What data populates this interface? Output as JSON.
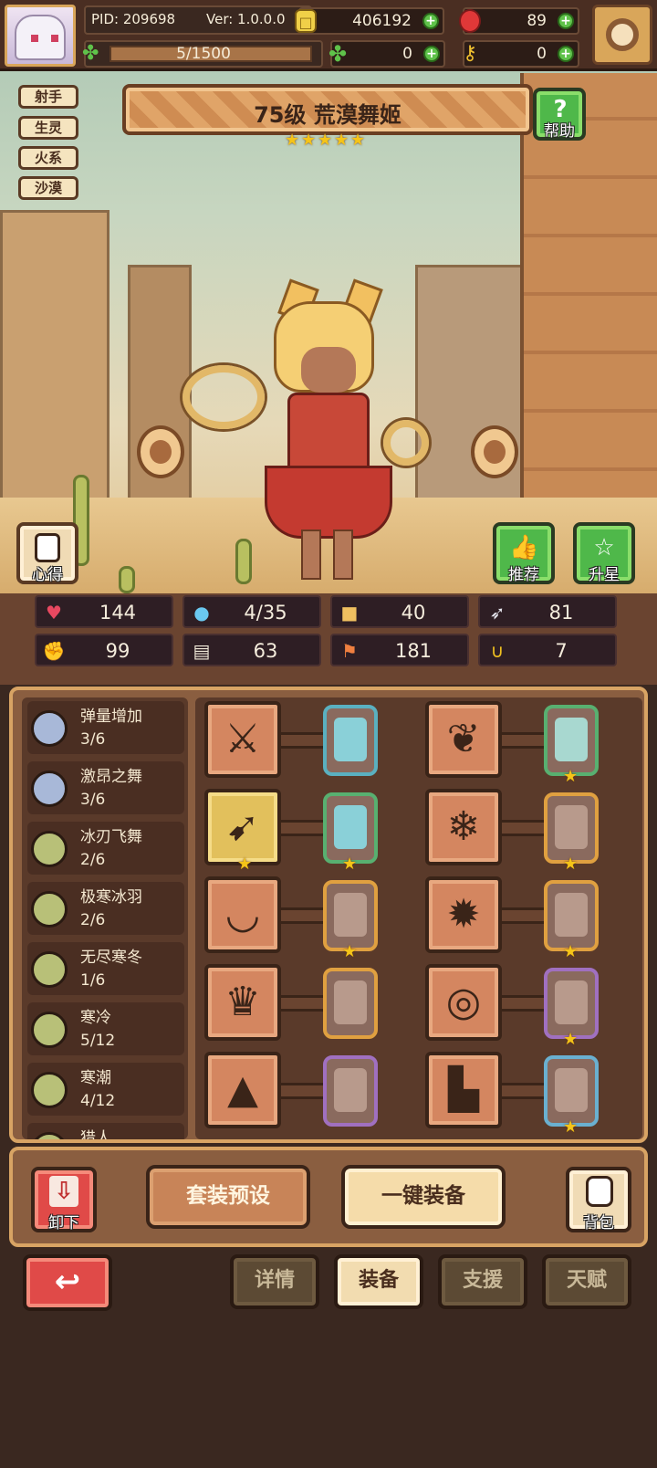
{
  "player": {
    "pid": "PID: 209698",
    "version": "Ver: 1.0.0.0",
    "energy": "5/1500"
  },
  "currency": {
    "gold": "406192",
    "ruby": "89",
    "clover": "0",
    "key": "0"
  },
  "tags": [
    "射手",
    "生灵",
    "火系",
    "沙漠"
  ],
  "hero": {
    "title": "75级  荒漠舞姬",
    "stars": 5
  },
  "buttons": {
    "help": "帮助",
    "insight": "心得",
    "recommend": "推荐",
    "star_up": "升星",
    "unload": "卸下",
    "set_preset": "套装预设",
    "one_click_equip": "一键装备",
    "backpack": "背包"
  },
  "icons": {
    "help": "?",
    "back": "↩"
  },
  "stats": [
    {
      "icon": "heart-icon",
      "glyph": "♥",
      "value": "144",
      "color": "#e84860"
    },
    {
      "icon": "water-drop-icon",
      "glyph": "●",
      "value": "4/35",
      "color": "#6ac8f0"
    },
    {
      "icon": "shield-icon",
      "glyph": "■",
      "value": "40",
      "color": "#f0c060"
    },
    {
      "icon": "wing-icon",
      "glyph": "➶",
      "value": "81",
      "color": "#e8e8f0"
    },
    {
      "icon": "fist-icon",
      "glyph": "✊",
      "value": "99",
      "color": "#9ad0f0"
    },
    {
      "icon": "book-icon",
      "glyph": "▤",
      "value": "63",
      "color": "#f0e8d8"
    },
    {
      "icon": "flag-icon",
      "glyph": "⚑",
      "value": "181",
      "color": "#f08040"
    },
    {
      "icon": "horseshoe-icon",
      "glyph": "∪",
      "value": "7",
      "color": "#f0c020"
    }
  ],
  "skills": [
    {
      "name": "弹量增加",
      "count": "3/6",
      "color": "#a8b8d8"
    },
    {
      "name": "激昂之舞",
      "count": "3/6",
      "color": "#a8b8d8"
    },
    {
      "name": "冰刃飞舞",
      "count": "2/6",
      "color": "#b8c078"
    },
    {
      "name": "极寒冰羽",
      "count": "2/6",
      "color": "#b8c078"
    },
    {
      "name": "无尽寒冬",
      "count": "1/6",
      "color": "#b8c078"
    },
    {
      "name": "寒冷",
      "count": "5/12",
      "color": "#b8c078"
    },
    {
      "name": "寒潮",
      "count": "4/12",
      "color": "#b8c078"
    },
    {
      "name": "猎人",
      "count": "",
      "color": "#b8c078"
    }
  ],
  "equipment": [
    {
      "slot": "crossbow",
      "glyph": "⚔",
      "gold": false,
      "gem_color": "#8ad0d8",
      "gem_border": "#5ab0c0",
      "gem_star": false
    },
    {
      "slot": "necklace-red",
      "glyph": "❦",
      "gold": false,
      "gem_color": "#a8d8d0",
      "gem_border": "#58b070",
      "gem_star": true
    },
    {
      "slot": "arrow",
      "glyph": "➹",
      "gold": true,
      "gem_color": "#8ad0d8",
      "gem_border": "#58b070",
      "gem_star": true
    },
    {
      "slot": "ice-armor",
      "glyph": "❄",
      "gold": false,
      "gem_color": "#b89a8c",
      "gem_border": "#e0a040",
      "gem_star": true
    },
    {
      "slot": "ice-collar",
      "glyph": "◡",
      "gold": false,
      "gem_color": "#b89a8c",
      "gem_border": "#e0a040",
      "gem_star": true
    },
    {
      "slot": "sun-ring",
      "glyph": "✹",
      "gold": false,
      "gem_color": "#b89a8c",
      "gem_border": "#e0a040",
      "gem_star": true
    },
    {
      "slot": "ice-crown",
      "glyph": "♛",
      "gold": false,
      "gem_color": "#b89a8c",
      "gem_border": "#e0a040",
      "gem_star": false
    },
    {
      "slot": "red-belt",
      "glyph": "◎",
      "gold": false,
      "gem_color": "#b89a8c",
      "gem_border": "#a070c0",
      "gem_star": true
    },
    {
      "slot": "ice-helm",
      "glyph": "▲",
      "gold": false,
      "gem_color": "#b89a8c",
      "gem_border": "#a070c0",
      "gem_star": false
    },
    {
      "slot": "ice-boots",
      "glyph": "▙",
      "gold": false,
      "gem_color": "#b89a8c",
      "gem_border": "#6ab0d0",
      "gem_star": true
    }
  ],
  "tabs": [
    {
      "label": "详情",
      "active": false
    },
    {
      "label": "装备",
      "active": true
    },
    {
      "label": "支援",
      "active": false
    },
    {
      "label": "天赋",
      "active": false
    }
  ]
}
